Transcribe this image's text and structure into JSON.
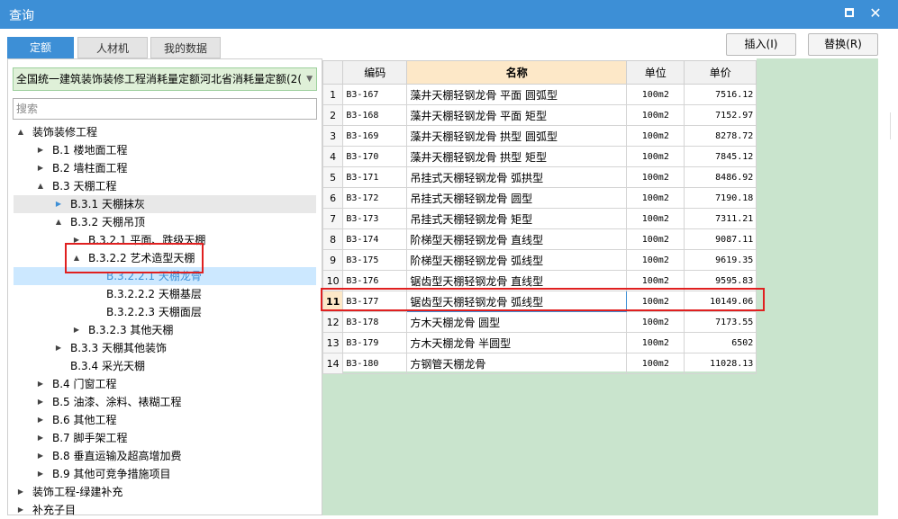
{
  "window": {
    "title": "查询"
  },
  "tabs": [
    {
      "label": "定额",
      "active": true
    },
    {
      "label": "人材机",
      "active": false
    },
    {
      "label": "我的数据",
      "active": false
    }
  ],
  "toolbar": {
    "insert_label": "插入(I)",
    "replace_label": "替换(R)"
  },
  "quota_selector": {
    "value": "全国统一建筑装饰装修工程消耗量定额河北省消耗量定额(2("
  },
  "search": {
    "placeholder": "搜索"
  },
  "tree": [
    {
      "label": "装饰装修工程",
      "toggle": "▲",
      "state": ""
    },
    {
      "label": "B.1 楼地面工程",
      "toggle": "▶",
      "state": ""
    },
    {
      "label": "B.2 墙柱面工程",
      "toggle": "▶",
      "state": ""
    },
    {
      "label": "B.3 天棚工程",
      "toggle": "▲",
      "state": ""
    },
    {
      "label": "B.3.1 天棚抹灰",
      "toggle": "▶",
      "state": "gray"
    },
    {
      "label": "B.3.2 天棚吊顶",
      "toggle": "▲",
      "state": ""
    },
    {
      "label": "B.3.2.1 平面、跌级天棚",
      "toggle": "▶",
      "state": ""
    },
    {
      "label": "B.3.2.2 艺术造型天棚",
      "toggle": "▲",
      "state": ""
    },
    {
      "label": "B.3.2.2.1 天棚龙骨",
      "toggle": "",
      "state": "blue"
    },
    {
      "label": "B.3.2.2.2 天棚基层",
      "toggle": "",
      "state": ""
    },
    {
      "label": "B.3.2.2.3 天棚面层",
      "toggle": "",
      "state": ""
    },
    {
      "label": "B.3.2.3 其他天棚",
      "toggle": "▶",
      "state": ""
    },
    {
      "label": "B.3.3 天棚其他装饰",
      "toggle": "▶",
      "state": ""
    },
    {
      "label": "B.3.4 采光天棚",
      "toggle": "",
      "state": ""
    },
    {
      "label": "B.4 门窗工程",
      "toggle": "▶",
      "state": ""
    },
    {
      "label": "B.5 油漆、涂料、裱糊工程",
      "toggle": "▶",
      "state": ""
    },
    {
      "label": "B.6 其他工程",
      "toggle": "▶",
      "state": ""
    },
    {
      "label": "B.7 脚手架工程",
      "toggle": "▶",
      "state": ""
    },
    {
      "label": "B.8 垂直运输及超高增加费",
      "toggle": "▶",
      "state": ""
    },
    {
      "label": "B.9 其他可竞争措施项目",
      "toggle": "▶",
      "state": ""
    },
    {
      "label": "装饰工程-绿建补充",
      "toggle": "▶",
      "state": ""
    },
    {
      "label": "补充子目",
      "toggle": "▶",
      "state": ""
    }
  ],
  "grid": {
    "columns": [
      "编码",
      "名称",
      "单位",
      "单价"
    ],
    "selected_row": 11,
    "rows": [
      {
        "idx": "1",
        "code": "B3-167",
        "name": "藻井天棚轻钢龙骨 平面 圆弧型",
        "unit": "100m2",
        "price": "7516.12"
      },
      {
        "idx": "2",
        "code": "B3-168",
        "name": "藻井天棚轻钢龙骨 平面 矩型",
        "unit": "100m2",
        "price": "7152.97"
      },
      {
        "idx": "3",
        "code": "B3-169",
        "name": "藻井天棚轻钢龙骨 拱型 圆弧型",
        "unit": "100m2",
        "price": "8278.72"
      },
      {
        "idx": "4",
        "code": "B3-170",
        "name": "藻井天棚轻钢龙骨 拱型 矩型",
        "unit": "100m2",
        "price": "7845.12"
      },
      {
        "idx": "5",
        "code": "B3-171",
        "name": "吊挂式天棚轻钢龙骨 弧拱型",
        "unit": "100m2",
        "price": "8486.92"
      },
      {
        "idx": "6",
        "code": "B3-172",
        "name": "吊挂式天棚轻钢龙骨 圆型",
        "unit": "100m2",
        "price": "7190.18"
      },
      {
        "idx": "7",
        "code": "B3-173",
        "name": "吊挂式天棚轻钢龙骨 矩型",
        "unit": "100m2",
        "price": "7311.21"
      },
      {
        "idx": "8",
        "code": "B3-174",
        "name": "阶梯型天棚轻钢龙骨 直线型",
        "unit": "100m2",
        "price": "9087.11"
      },
      {
        "idx": "9",
        "code": "B3-175",
        "name": "阶梯型天棚轻钢龙骨 弧线型",
        "unit": "100m2",
        "price": "9619.35"
      },
      {
        "idx": "10",
        "code": "B3-176",
        "name": "锯齿型天棚轻钢龙骨 直线型",
        "unit": "100m2",
        "price": "9595.83"
      },
      {
        "idx": "11",
        "code": "B3-177",
        "name": "锯齿型天棚轻钢龙骨 弧线型",
        "unit": "100m2",
        "price": "10149.06"
      },
      {
        "idx": "12",
        "code": "B3-178",
        "name": "方木天棚龙骨 圆型",
        "unit": "100m2",
        "price": "7173.55"
      },
      {
        "idx": "13",
        "code": "B3-179",
        "name": "方木天棚龙骨 半圆型",
        "unit": "100m2",
        "price": "6502"
      },
      {
        "idx": "14",
        "code": "B3-180",
        "name": "方钢管天棚龙骨",
        "unit": "100m2",
        "price": "11028.13"
      }
    ]
  }
}
